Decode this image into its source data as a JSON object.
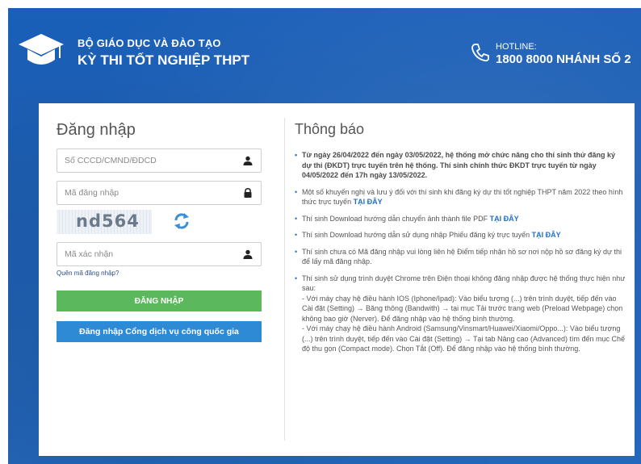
{
  "header": {
    "org_line1": "BỘ GIÁO DỤC VÀ ĐÀO TẠO",
    "org_line2": "KỲ THI TỐT NGHIỆP THPT",
    "hotline_label": "HOTLINE:",
    "hotline_number": "1800 8000 NHÁNH SỐ 2"
  },
  "login": {
    "title": "Đăng nhập",
    "id_placeholder": "Số CCCD/CMND/ĐDCD",
    "password_placeholder": "Mã đăng nhập",
    "captcha_text": "nd564",
    "captcha_input_placeholder": "Mã xác nhận",
    "forgot_link": "Quên mã đăng nhập?",
    "login_button": "ĐĂNG NHẬP",
    "national_portal_button": "Đăng nhập Cổng dịch vụ công quốc gia"
  },
  "notices": {
    "title": "Thông báo",
    "items": [
      {
        "text": "Từ ngày 26/04/2022 đến ngày 03/05/2022, hệ thống mở chức năng cho thí sinh thử đăng ký dự thi (ĐKDT) trực tuyến trên hệ thống. Thí sinh chính thức ĐKDT trực tuyến từ ngày 04/05/2022 đến 17h ngày 13/05/2022.",
        "link": ""
      },
      {
        "text": "Một số khuyến nghị và lưu ý đối với thí sinh khi đăng ký dự thi tốt nghiệp THPT năm 2022 theo hình thức trực tuyến ",
        "link": "TẠI ĐÂY"
      },
      {
        "text": "Thí sinh Download hướng dẫn chuyển ảnh thành file PDF ",
        "link": "TẠI ĐÂY"
      },
      {
        "text": "Thí sinh Download hướng dẫn sử dụng nhập Phiếu đăng ký trực tuyến ",
        "link": "TẠI ĐÂY"
      },
      {
        "text": "Thí sinh chưa có Mã đăng nhập vui lòng liên hệ Điểm tiếp nhận hồ sơ nơi nộp hồ sơ đăng ký dự thi để lấy mã đăng nhập.",
        "link": ""
      },
      {
        "text": "Thí sinh sử dụng trình duyệt Chrome trên Điện thoại không đăng nhập được hệ thống thực hiện như sau:\n - Với máy chạy hệ điều hành IOS (Iphone/Ipad): Vào biểu tượng (...) trên trình duyệt, tiếp đến vào Cài đặt (Setting) → Băng thông (Bandwith) → tại mục Tải trước trang web (Preload Webpage) chọn không bao giờ (Nerver). Để đăng nhập vào hệ thống bình thường.\n - Với máy chạy hệ điều hành Android (Samsung/Vinsmart/Huawei/Xiaomi/Oppo...): Vào biểu tượng (...) trên trình duyệt, tiếp đến vào Cài đặt (Setting) → Tại tab Nâng cao (Advanced) tìm đến mục Chế độ thu gọn (Compact mode). Chọn Tắt (Off). Để đăng nhập vào hệ thống bình thường.",
        "link": ""
      }
    ]
  },
  "icons": {
    "logo": "graduation-cap-icon",
    "phone": "phone-icon",
    "user": "user-icon",
    "lock": "lock-icon",
    "refresh": "refresh-icon"
  },
  "colors": {
    "header_blue": "#1d5db0",
    "login_green": "#5cb85c",
    "portal_blue": "#2f8ad6",
    "link_blue": "#1f6fc4"
  }
}
